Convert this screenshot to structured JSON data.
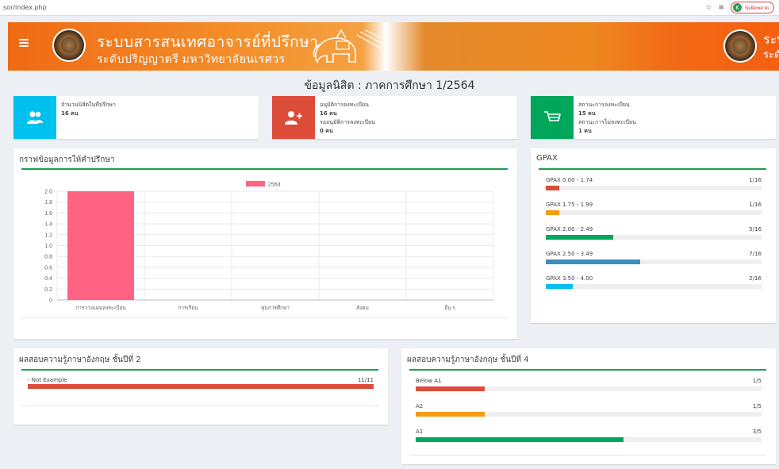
{
  "browser": {
    "url": "sor/index.php",
    "star_icon": "star-icon",
    "reading_list_icon": "reading-list-icon",
    "profile_initial": "K",
    "profile_label": "ข้อผิดพลาด"
  },
  "header": {
    "title_line1": "ระบบสารสนเทศอาจารย์ที่ปรึกษา",
    "title_line2": "ระดับปริญญาตรี  มหาวิทยาลัยนเรศวร",
    "title_right_line1": "ระบ",
    "title_right_line2": "ระดั"
  },
  "page_title": "ข้อมูลนิสิต : ภาคการศึกษา 1/2564",
  "info_boxes": [
    {
      "color": "#00c0ef",
      "icon": "users-icon",
      "lines": [
        "จำนวนนิสิตในที่ปรึกษา",
        "16 คน"
      ]
    },
    {
      "color": "#dd4b39",
      "icon": "add-user-icon",
      "lines": [
        "อนุมัติการลงทะเบียน",
        "16 คน",
        "รออนุมัติการลงทะเบียน",
        "0 คน"
      ]
    },
    {
      "color": "#00a65a",
      "icon": "cart-icon",
      "lines": [
        "สถานะการลงทะเบียน",
        "15 คน",
        "สถานะการไม่ลงทะเบียน",
        "1 คน"
      ]
    }
  ],
  "chart_panel": {
    "title": "กราฟข้อมูลการให้คำปรึกษา"
  },
  "chart_data": {
    "type": "bar",
    "categories": [
      "การวางแผนลงทะเบียน",
      "การเรียน",
      "ทุนการศึกษา",
      "สังคม",
      "อื่น ๆ"
    ],
    "series": [
      {
        "name": "2564",
        "color": "#ff6384",
        "values": [
          2,
          0,
          0,
          0,
          0
        ]
      }
    ],
    "ylim": [
      0,
      2.0
    ],
    "yticks": [
      "0",
      "0.2",
      "0.4",
      "0.6",
      "0.8",
      "1.0",
      "1.2",
      "1.4",
      "1.6",
      "1.8",
      "2.0"
    ],
    "legend": "top-center",
    "grid": true
  },
  "gpax_panel": {
    "title": "GPAX",
    "rows": [
      {
        "label": "GPAX 0.00 - 1.74",
        "count": "1/16",
        "value": 1,
        "total": 16,
        "color": "#dd4b39"
      },
      {
        "label": "GPAX 1.75 - 1.99",
        "count": "1/16",
        "value": 1,
        "total": 16,
        "color": "#f39c12"
      },
      {
        "label": "GPAX 2.00 - 2.49",
        "count": "5/16",
        "value": 5,
        "total": 16,
        "color": "#00a65a"
      },
      {
        "label": "GPAX 2.50 - 3.49",
        "count": "7/16",
        "value": 7,
        "total": 16,
        "color": "#3c8dbc"
      },
      {
        "label": "GPAX 3.50 - 4.00",
        "count": "2/16",
        "value": 2,
        "total": 16,
        "color": "#00c0ef"
      }
    ]
  },
  "english2_panel": {
    "title": "ผลสอบความรู้ภาษาอังกฤษ ชั้นปีที่ 2",
    "rows": [
      {
        "label": "- Not Example",
        "count": "11/11",
        "value": 11,
        "total": 11,
        "color": "#dd4b39"
      }
    ]
  },
  "english4_panel": {
    "title": "ผลสอบความรู้ภาษาอังกฤษ ชั้นปีที่ 4",
    "rows": [
      {
        "label": "Below A1",
        "count": "1/5",
        "value": 1,
        "total": 5,
        "color": "#dd4b39"
      },
      {
        "label": "A2",
        "count": "1/5",
        "value": 1,
        "total": 5,
        "color": "#f39c12"
      },
      {
        "label": "A1",
        "count": "3/5",
        "value": 3,
        "total": 5,
        "color": "#00a65a"
      }
    ]
  }
}
